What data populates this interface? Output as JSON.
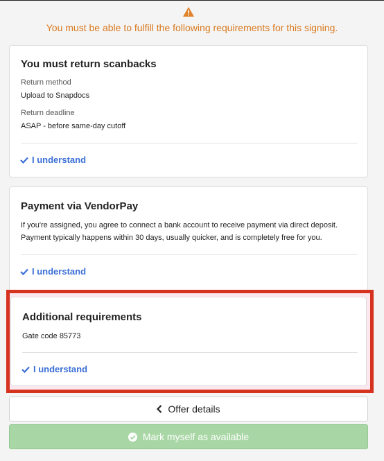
{
  "warning": {
    "icon": "warning-triangle-icon",
    "text": "You must be able to fulfill the following requirements for this signing.",
    "color": "#d9791e"
  },
  "scanbacks": {
    "title": "You must return scanbacks",
    "return_method_label": "Return method",
    "return_method_value": "Upload to Snapdocs",
    "return_deadline_label": "Return deadline",
    "return_deadline_value": "ASAP - before same-day cutoff",
    "understand_label": "I understand"
  },
  "vendorpay": {
    "title": "Payment via VendorPay",
    "line1": "If you're assigned, you agree to connect a bank account to receive payment via direct deposit.",
    "line2": "Payment typically happens within 30 days, usually quicker, and is completely free for you.",
    "understand_label": "I understand"
  },
  "additional": {
    "title": "Additional requirements",
    "detail": "Gate code 85773",
    "understand_label": "I understand"
  },
  "actions": {
    "offer_details_label": "Offer details",
    "mark_available_label": "Mark myself as available"
  },
  "colors": {
    "accent_blue": "#3b6fd6",
    "highlight_red": "#d5321f",
    "available_green": "#a8d7a5"
  }
}
